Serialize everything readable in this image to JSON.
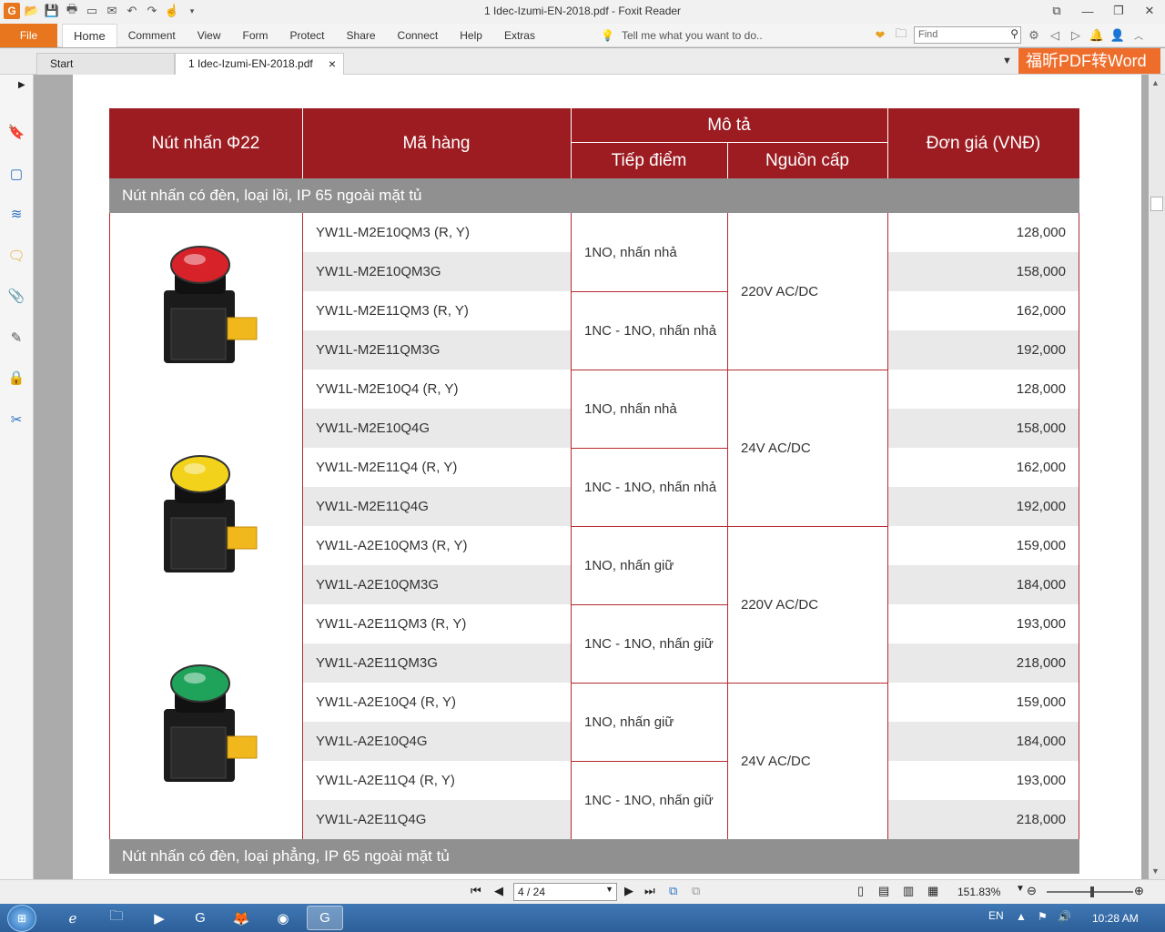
{
  "window": {
    "title": "1 Idec-Izumi-EN-2018.pdf - Foxit Reader",
    "controls": [
      "⧉",
      "—",
      "❐",
      "✕"
    ]
  },
  "ribbon": {
    "file_label": "File",
    "tabs": [
      "Home",
      "Comment",
      "View",
      "Form",
      "Protect",
      "Share",
      "Connect",
      "Help",
      "Extras"
    ],
    "tell_me": "Tell me what you want to do..",
    "find_placeholder": "Find"
  },
  "doc_tabs": {
    "start": "Start",
    "file": "1 Idec-Izumi-EN-2018.pdf",
    "promo": "福昕PDF转Word"
  },
  "table": {
    "headers": {
      "product": "Nút nhấn Φ22",
      "code": "Mã hàng",
      "desc": "Mô tả",
      "contact": "Tiếp điểm",
      "power": "Nguồn cấp",
      "price": "Đơn giá (VNĐ)"
    },
    "sections": [
      "Nút nhấn có đèn, loại lồi, IP 65 ngoài mặt tủ",
      "Nút nhấn có đèn, loại phẳng, IP 65 ngoài mặt tủ"
    ],
    "rows": [
      {
        "code": "YW1L-M2E10QM3 (R, Y)",
        "price": "128,000"
      },
      {
        "code": "YW1L-M2E10QM3G",
        "price": "158,000"
      },
      {
        "code": "YW1L-M2E11QM3 (R, Y)",
        "price": "162,000"
      },
      {
        "code": "YW1L-M2E11QM3G",
        "price": "192,000"
      },
      {
        "code": "YW1L-M2E10Q4 (R, Y)",
        "price": "128,000"
      },
      {
        "code": "YW1L-M2E10Q4G",
        "price": "158,000"
      },
      {
        "code": "YW1L-M2E11Q4 (R, Y)",
        "price": "162,000"
      },
      {
        "code": "YW1L-M2E11Q4G",
        "price": "192,000"
      },
      {
        "code": "YW1L-A2E10QM3 (R, Y)",
        "price": "159,000"
      },
      {
        "code": "YW1L-A2E10QM3G",
        "price": "184,000"
      },
      {
        "code": "YW1L-A2E11QM3 (R, Y)",
        "price": "193,000"
      },
      {
        "code": "YW1L-A2E11QM3G",
        "price": "218,000"
      },
      {
        "code": "YW1L-A2E10Q4 (R, Y)",
        "price": "159,000"
      },
      {
        "code": "YW1L-A2E10Q4G",
        "price": "184,000"
      },
      {
        "code": "YW1L-A2E11Q4 (R, Y)",
        "price": "193,000"
      },
      {
        "code": "YW1L-A2E11Q4G",
        "price": "218,000"
      }
    ],
    "contacts": [
      "1NO, nhấn nhả",
      "1NC - 1NO, nhấn nhả",
      "1NO, nhấn nhả",
      "1NC - 1NO, nhấn nhả",
      "1NO, nhấn giữ",
      "1NC - 1NO, nhấn giữ",
      "1NO, nhấn giữ",
      "1NC - 1NO, nhấn giữ"
    ],
    "power": [
      "220V AC/DC",
      "24V AC/DC",
      "220V AC/DC",
      "24V AC/DC"
    ],
    "button_colors": [
      "#d8222a",
      "#f2d21a",
      "#1fa35a"
    ]
  },
  "status": {
    "page_indicator": "4 / 24",
    "zoom": "151.83%"
  },
  "taskbar": {
    "lang": "EN",
    "time": "10:28 AM"
  }
}
